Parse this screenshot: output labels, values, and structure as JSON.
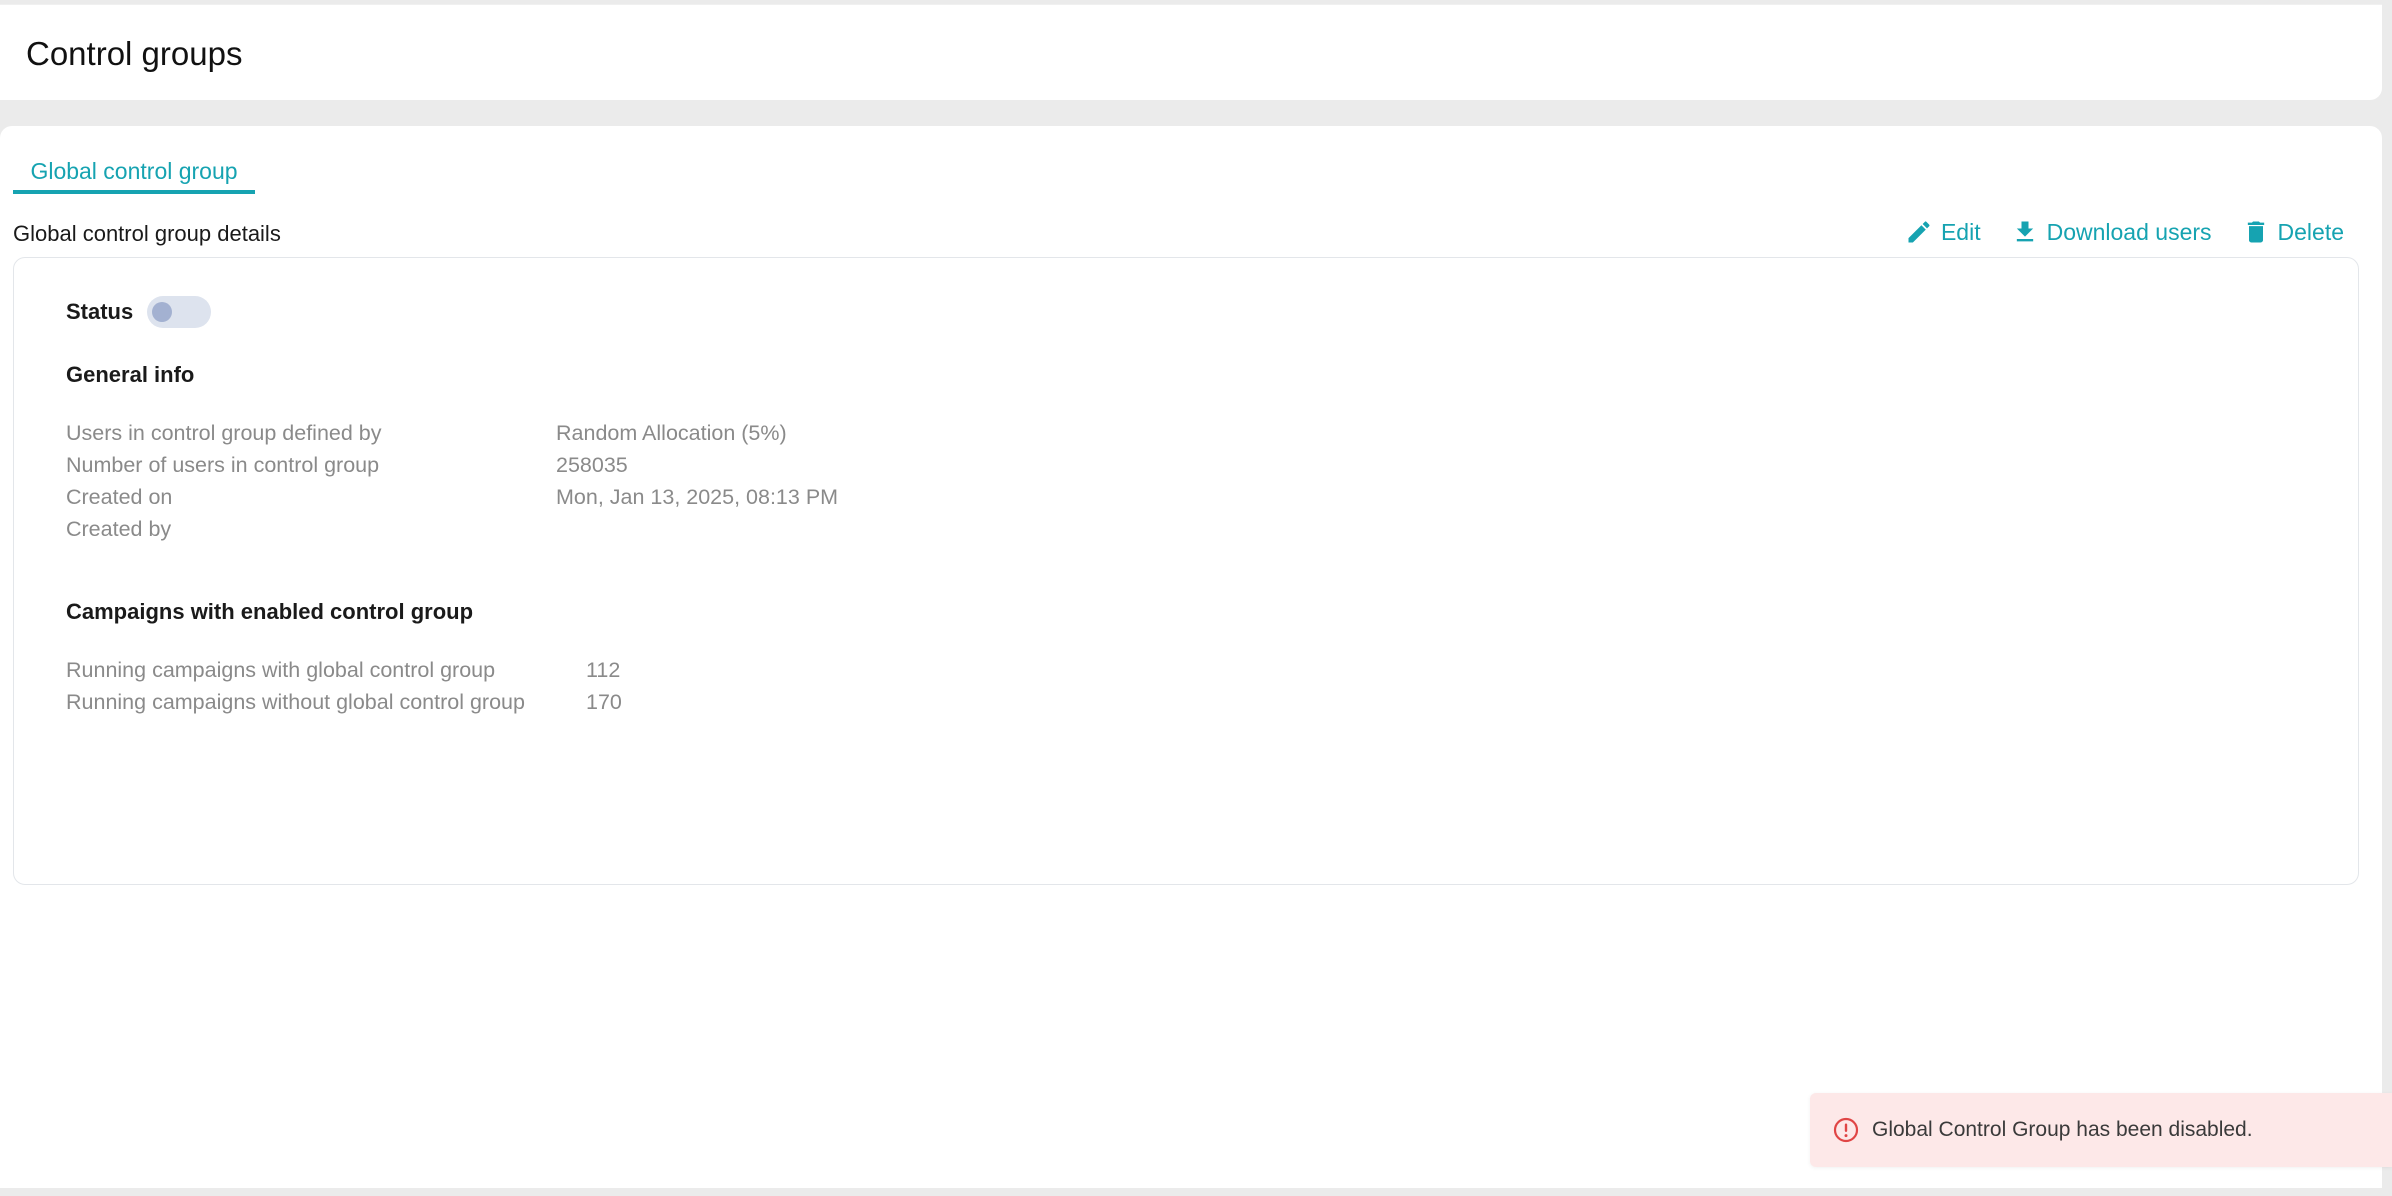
{
  "header": {
    "title": "Control groups"
  },
  "tabs": [
    {
      "label": "Global control group",
      "active": true
    }
  ],
  "section": {
    "title": "Global control group details"
  },
  "actions": {
    "edit_label": "Edit",
    "download_label": "Download users",
    "delete_label": "Delete"
  },
  "status": {
    "label": "Status",
    "enabled": false
  },
  "general_info": {
    "heading": "General info",
    "rows": [
      {
        "key": "Users in control group defined by",
        "value": "Random Allocation (5%)"
      },
      {
        "key": "Number of users in control group",
        "value": "258035"
      },
      {
        "key": "Created on",
        "value": "Mon, Jan 13, 2025, 08:13 PM"
      },
      {
        "key": "Created by",
        "value": ""
      }
    ]
  },
  "campaigns": {
    "heading": "Campaigns with enabled control group",
    "rows": [
      {
        "key": "Running campaigns with global control group",
        "value": "112"
      },
      {
        "key": "Running campaigns without global control group",
        "value": "170"
      }
    ]
  },
  "toast": {
    "message": "Global Control Group has been disabled.",
    "type": "error",
    "icon": "alert-circle-icon"
  },
  "colors": {
    "accent": "#16a3b1",
    "toast_bg": "#fde8e8",
    "toast_icon": "#e04545",
    "toggle_off": "#dde3ee"
  }
}
